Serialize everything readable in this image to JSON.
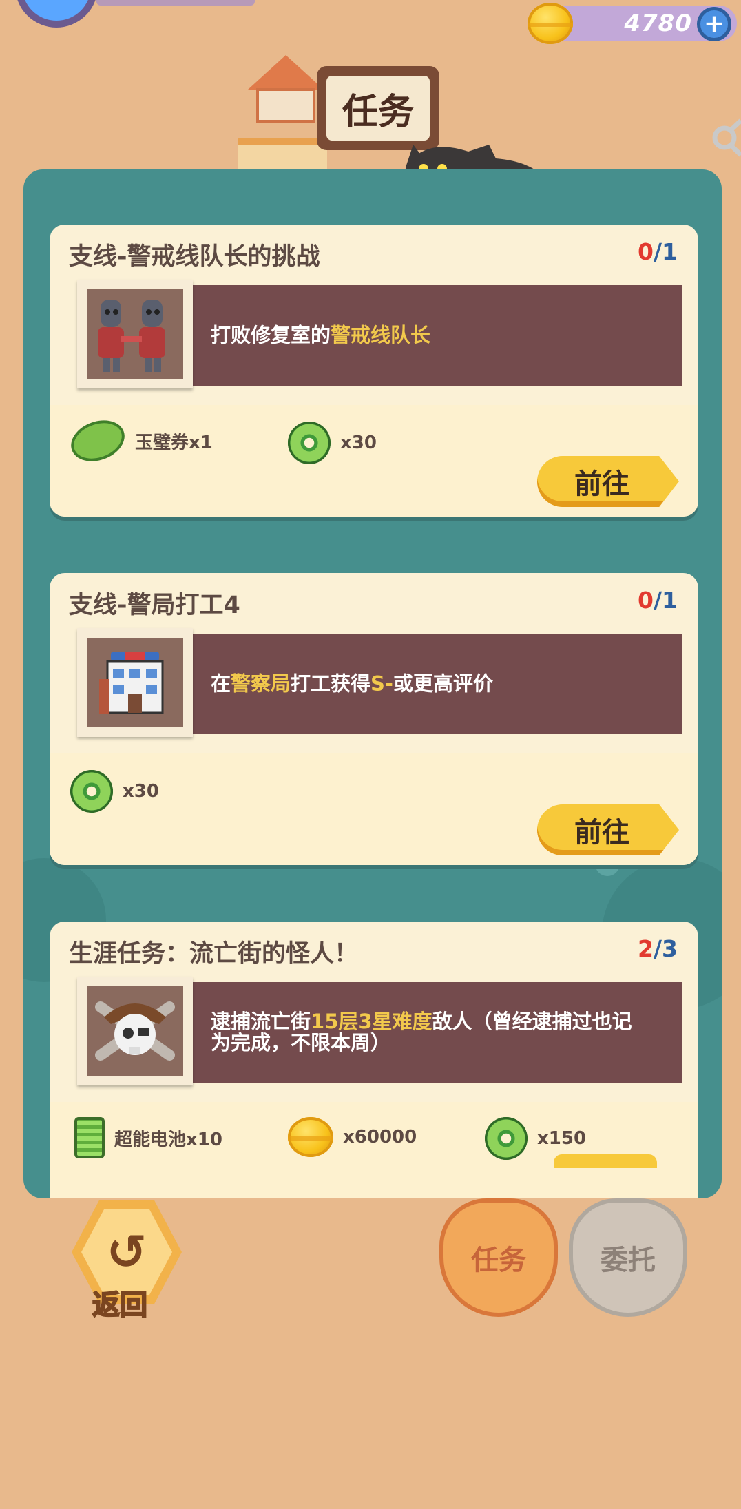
{
  "header": {
    "title": "任务",
    "coins": "4780",
    "plus_label": "+"
  },
  "tasks": [
    {
      "title": "支线-警戒线队长的挑战",
      "progress_current": "0",
      "progress_sep": "/",
      "progress_total": "1",
      "desc_parts": [
        "打败修复室的",
        "警戒线队长",
        ""
      ],
      "rewards": [
        {
          "icon": "jade-ticket-icon",
          "label": "玉璧券x1"
        },
        {
          "icon": "green-donut-icon",
          "label": "x30"
        }
      ],
      "button": "前往"
    },
    {
      "title": "支线-警局打工4",
      "progress_current": "0",
      "progress_sep": "/",
      "progress_total": "1",
      "desc_parts": [
        "在",
        "警察局",
        "打工获得",
        "S-",
        "或更高评价"
      ],
      "rewards": [
        {
          "icon": "green-donut-icon",
          "label": "x30"
        }
      ],
      "button": "前往"
    },
    {
      "title": "生涯任务：流亡街的怪人！",
      "progress_current": "2",
      "progress_sep": "/",
      "progress_total": "3",
      "desc_parts": [
        "逮捕流亡街",
        "15层3星难度",
        "敌人（曾经逮捕过也记为完成，不限本周）"
      ],
      "rewards": [
        {
          "icon": "battery-icon",
          "label": "超能电池x10"
        },
        {
          "icon": "gold-coin-icon",
          "label": "x60000"
        },
        {
          "icon": "green-donut-icon",
          "label": "x150"
        }
      ]
    }
  ],
  "bottom": {
    "back_label": "返回",
    "tab_task": "任务",
    "tab_entrust": "委托"
  },
  "colors": {
    "background": "#e8b98c",
    "panel": "#468f8d",
    "card": "#fbf1d6",
    "desc_box": "#744b4d",
    "highlight": "#f2c94c",
    "button": "#f7c93a"
  }
}
